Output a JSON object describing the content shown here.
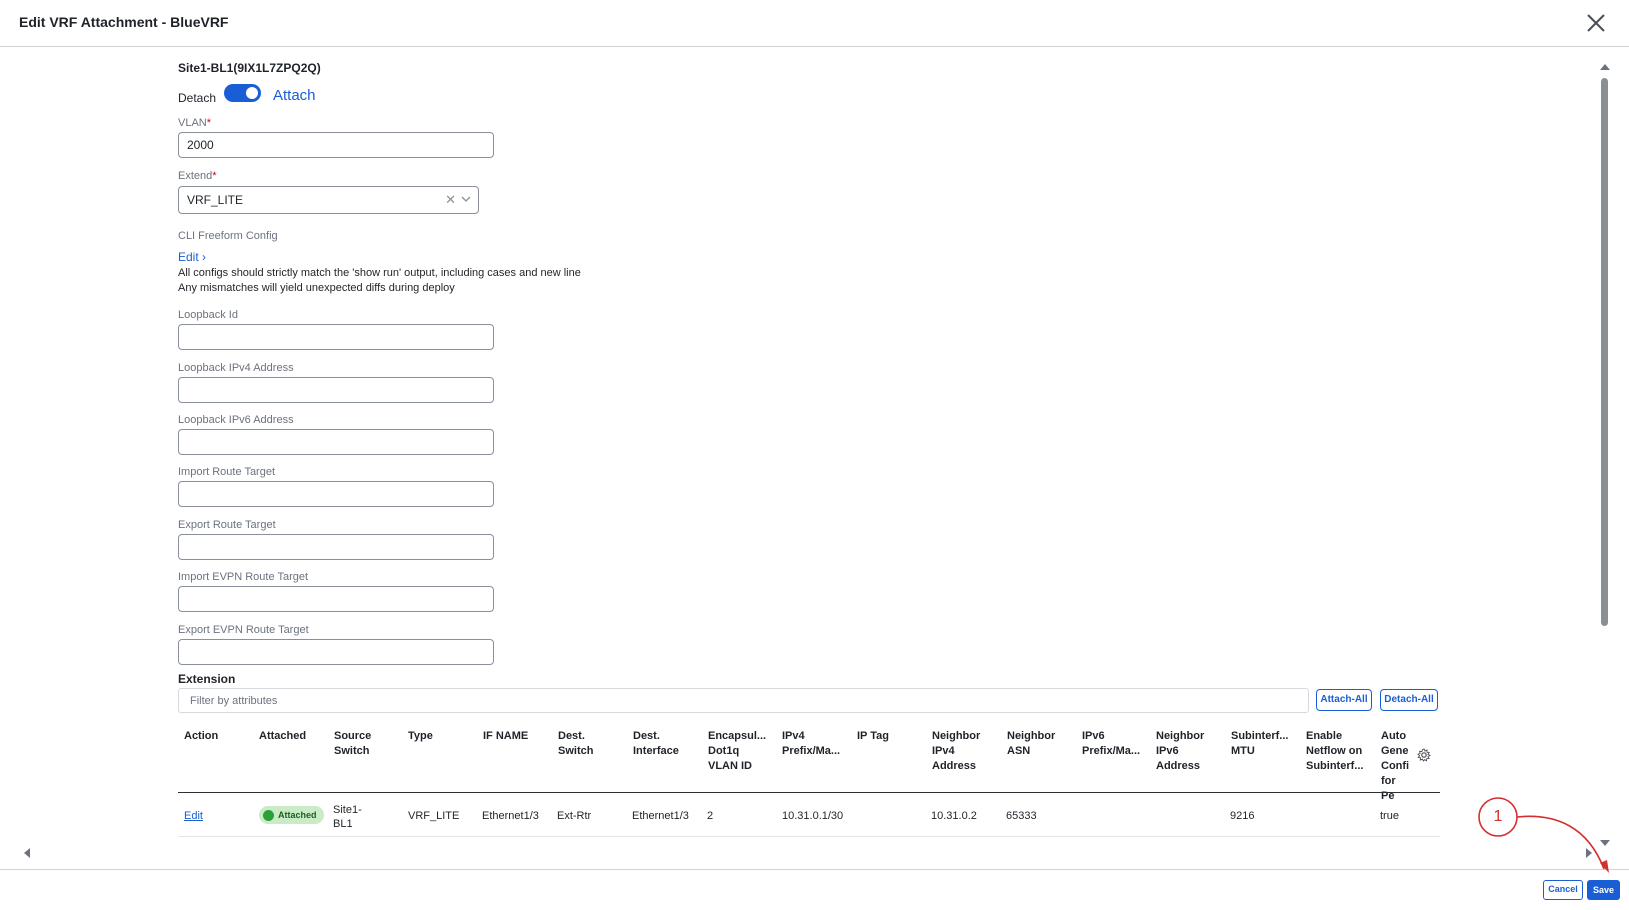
{
  "dialog": {
    "title": "Edit VRF Attachment - BlueVRF"
  },
  "switch": {
    "name": "Site1-BL1(9IX1L7ZPQ2Q)",
    "detach_label": "Detach",
    "attach_label": "Attach",
    "attached": true
  },
  "form": {
    "vlan_label": "VLAN",
    "vlan_value": "2000",
    "extend_label": "Extend",
    "extend_value": "VRF_LITE",
    "required_mark": "*",
    "cli_label": "CLI Freeform Config",
    "edit_link": "Edit",
    "note_line1": "All configs should strictly match the 'show run' output, including cases and new line",
    "note_line2": "Any mismatches will yield unexpected diffs during deploy",
    "loopback_id_label": "Loopback Id",
    "loopback_ipv4_label": "Loopback IPv4 Address",
    "loopback_ipv6_label": "Loopback IPv6 Address",
    "import_rt_label": "Import Route Target",
    "export_rt_label": "Export Route Target",
    "import_evpn_rt_label": "Import EVPN Route Target",
    "export_evpn_rt_label": "Export EVPN Route Target"
  },
  "extension": {
    "title": "Extension",
    "filter_placeholder": "Filter by attributes",
    "attach_all": "Attach-All",
    "detach_all": "Detach-All",
    "columns": [
      [
        "Action"
      ],
      [
        "Attached"
      ],
      [
        "Source",
        "Switch"
      ],
      [
        "Type"
      ],
      [
        "IF NAME"
      ],
      [
        "Dest.",
        "Switch"
      ],
      [
        "Dest.",
        "Interface"
      ],
      [
        "Encapsul...",
        "Dot1q",
        "VLAN ID"
      ],
      [
        "IPv4",
        "Prefix/Ma..."
      ],
      [
        "IP Tag"
      ],
      [
        "Neighbor",
        "IPv4",
        "Address"
      ],
      [
        "Neighbor",
        "ASN"
      ],
      [
        "IPv6",
        "Prefix/Ma..."
      ],
      [
        "Neighbor",
        "IPv6",
        "Address"
      ],
      [
        "Subinterf...",
        "MTU"
      ],
      [
        "Enable",
        "Netflow on",
        "Subinterf..."
      ],
      [
        "Auto",
        "Gene",
        "Confi",
        "for Pe"
      ]
    ],
    "row": {
      "action": "Edit",
      "attached": "Attached",
      "source_switch_1": "Site1-",
      "source_switch_2": "BL1",
      "type": "VRF_LITE",
      "if_name": "Ethernet1/3",
      "dest_switch": "Ext-Rtr",
      "dest_interface": "Ethernet1/3",
      "vlan_id": "2",
      "ipv4_prefix": "10.31.0.1/30",
      "ip_tag": "",
      "neighbor_ipv4": "10.31.0.2",
      "neighbor_asn": "65333",
      "ipv6_prefix": "",
      "neighbor_ipv6": "",
      "mtu": "9216",
      "netflow": "",
      "auto_generate": "true"
    }
  },
  "footer": {
    "cancel": "Cancel",
    "save": "Save"
  },
  "annotation": {
    "step": "1",
    "color": "#d32f2f"
  },
  "colors": {
    "accent": "#1a5ed6",
    "success": "#2e9e3a"
  }
}
